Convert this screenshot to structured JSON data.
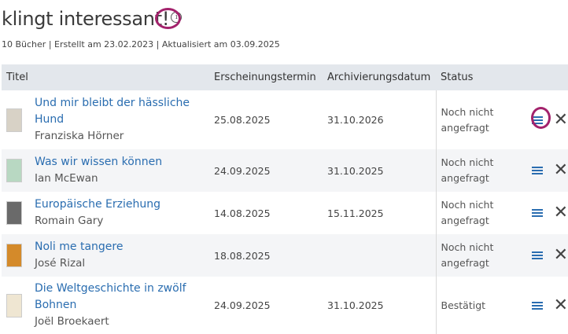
{
  "header": {
    "title": "klingt interessant!",
    "info_icon": "i",
    "subtitle": "10 Bücher | Erstellt am 23.02.2023 | Aktualisiert am 03.09.2025"
  },
  "table": {
    "columns": [
      "Titel",
      "Erscheinungstermin",
      "Archivierungsdatum",
      "Status"
    ],
    "rows": [
      {
        "title": "Und mir bleibt der hässliche Hund",
        "author": "Franziska Hörner",
        "release": "25.08.2025",
        "archive": "31.10.2026",
        "status": "Noch nicht angefragt",
        "cover_color": "#d8d2c6"
      },
      {
        "title": "Was wir wissen können",
        "author": "Ian McEwan",
        "release": "24.09.2025",
        "archive": "31.10.2025",
        "status": "Noch nicht angefragt",
        "cover_color": "#b8d8c2"
      },
      {
        "title": "Europäische Erziehung",
        "author": "Romain Gary",
        "release": "14.08.2025",
        "archive": "15.11.2025",
        "status": "Noch nicht angefragt",
        "cover_color": "#6a6a6a"
      },
      {
        "title": "Noli me tangere",
        "author": "José Rizal",
        "release": "18.08.2025",
        "archive": "",
        "status": "Noch nicht angefragt",
        "cover_color": "#d48a2a"
      },
      {
        "title": "Die Weltgeschichte in zwölf Bohnen",
        "author": "Joël Broekaert",
        "release": "24.09.2025",
        "archive": "31.10.2025",
        "status": "Bestätigt",
        "cover_color": "#efe6d2"
      }
    ]
  },
  "icons": {
    "menu": "menu-icon",
    "close": "close-icon",
    "close_glyph": "✕"
  },
  "colors": {
    "link": "#2a6db0",
    "header_bg": "#e3e7ec",
    "highlight": "#a3226c"
  }
}
